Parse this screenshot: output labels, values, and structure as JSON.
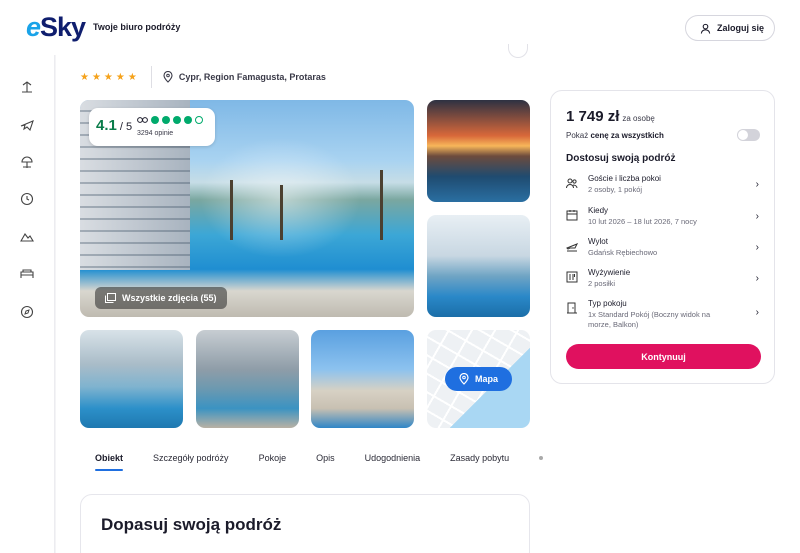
{
  "header": {
    "logo": "eSky",
    "tagline": "Twoje biuro podróży",
    "login_label": "Zaloguj się"
  },
  "sidebar": {
    "items": [
      {
        "icon": "beach-palm-icon"
      },
      {
        "icon": "plane-icon"
      },
      {
        "icon": "sun-umbrella-icon"
      },
      {
        "icon": "clock-icon"
      },
      {
        "icon": "mountain-icon"
      },
      {
        "icon": "bed-icon"
      },
      {
        "icon": "compass-icon"
      }
    ]
  },
  "hotel": {
    "stars": "★★★★★",
    "location": "Cypr, Region Famagusta, Protaras"
  },
  "rating": {
    "score": "4.1",
    "scale": " / 5",
    "reviews": "3294 opinie",
    "dots_filled": 4,
    "dots_total": 5
  },
  "gallery": {
    "all_photos": "Wszystkie zdjęcia (55)",
    "map_label": "Mapa"
  },
  "tabs": [
    "Obiekt",
    "Szczegóły podróży",
    "Pokoje",
    "Opis",
    "Udogodnienia",
    "Zasady pobytu"
  ],
  "section": {
    "title": "Dopasuj swoją podróż"
  },
  "booking": {
    "price": "1 749 zł",
    "price_unit": "za osobę",
    "all_price_prefix": "Pokaż ",
    "all_price_bold": "cenę za wszystkich",
    "heading": "Dostosuj swoją podróż",
    "options": [
      {
        "label": "Goście i liczba pokoi",
        "value": "2 osoby, 1 pokój",
        "icon": "guests-icon"
      },
      {
        "label": "Kiedy",
        "value": "10 lut 2026 – 18 lut 2026, 7 nocy",
        "icon": "calendar-icon"
      },
      {
        "label": "Wylot",
        "value": "Gdańsk Rębiechowo",
        "icon": "departure-icon"
      },
      {
        "label": "Wyżywienie",
        "value": "2 posiłki",
        "icon": "meal-icon"
      },
      {
        "label": "Typ pokoju",
        "value": "1x Standard Pokój (Boczny widok na morze, Balkon)",
        "icon": "door-icon"
      }
    ],
    "continue_label": "Kontynuuj"
  },
  "colors": {
    "brand_pink": "#e0115f",
    "brand_blue": "#1f6fe0",
    "tripadvisor_green": "#00aa6c",
    "star_orange": "#f5a21b"
  }
}
